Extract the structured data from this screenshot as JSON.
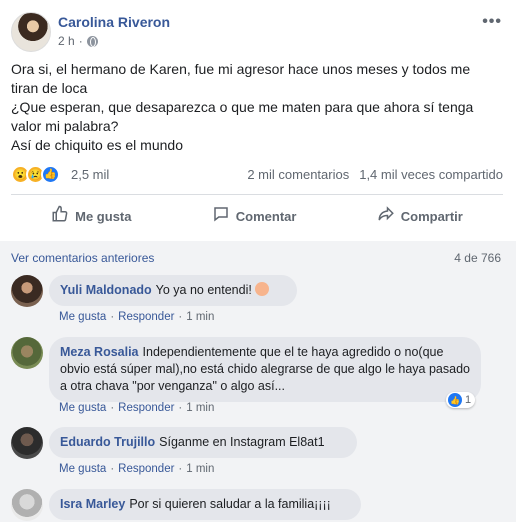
{
  "post": {
    "author": "Carolina Riveron",
    "time": "2 h",
    "privacy_icon": "globe-icon",
    "more_icon": "more-options-icon",
    "more_label": "•••",
    "text_lines": [
      "Ora si, el hermano de Karen, fue mi agresor hace unos meses y todos me tiran de loca",
      "¿Que esperan, que desaparezca o que me maten para que ahora sí tenga valor mi palabra?",
      "Así de chiquito es el mundo"
    ]
  },
  "reactions": {
    "icons": [
      "wow-reaction-icon",
      "sad-reaction-icon",
      "like-reaction-icon"
    ],
    "count": "2,5 mil",
    "comments": "2 mil comentarios",
    "shares": "1,4 mil veces compartido"
  },
  "actions": {
    "like": "Me gusta",
    "comment": "Comentar",
    "share": "Compartir"
  },
  "comments_section": {
    "view_previous": "Ver comentarios anteriores",
    "count": "4 de 766",
    "items": [
      {
        "name": "Yuli Maldonado",
        "text": "Yo ya no entendi!",
        "like_label": "Me gusta",
        "reply_label": "Responder",
        "time": "1 min"
      },
      {
        "name": "Meza Rosalia",
        "text": "Independientemente que el te haya agredido o no(que obvio está súper mal),no está chido alegrarse de que algo le haya pasado a otra chava \"por venganza\" o algo así...",
        "like_label": "Me gusta",
        "reply_label": "Responder",
        "time": "1 min",
        "likes": "1"
      },
      {
        "name": "Eduardo Trujillo",
        "text": "Síganme en Instagram El8at1",
        "like_label": "Me gusta",
        "reply_label": "Responder",
        "time": "1 min"
      },
      {
        "name": "Isra Marley",
        "text": "Por si quieren saludar a la familia¡¡¡¡"
      }
    ]
  },
  "colors": {
    "link": "#385898",
    "secondary_text": "#606770",
    "bubble": "#e4e6eb",
    "comments_bg": "#f2f3f5",
    "like_blue": "#2078f4",
    "reaction_yellow": "#f7b125"
  }
}
